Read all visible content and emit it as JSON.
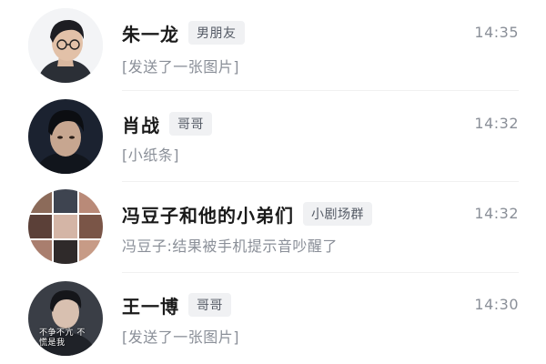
{
  "chats": [
    {
      "name": "朱一龙",
      "tag": "男朋友",
      "time": "14:35",
      "preview": "[发送了一张图片]",
      "avatar": "avatar-portrait-glasses"
    },
    {
      "name": "肖战",
      "tag": "哥哥",
      "time": "14:32",
      "preview": "[小纸条]",
      "avatar": "avatar-portrait-dark"
    },
    {
      "name": "冯豆子和他的小弟们",
      "tag": "小剧场群",
      "time": "14:32",
      "preview": "冯豆子:结果被手机提示音吵醒了",
      "avatar": "avatar-group-grid"
    },
    {
      "name": "王一博",
      "tag": "哥哥",
      "time": "14:30",
      "preview": "[发送了一张图片]",
      "avatar": "avatar-portrait-caption",
      "avatar_caption": "不争不亢 不慌是我"
    }
  ],
  "colors": {
    "name": "#1a1a1a",
    "meta": "#8a8f98",
    "tag_bg": "#f0f1f3",
    "tag_text": "#555b66"
  }
}
